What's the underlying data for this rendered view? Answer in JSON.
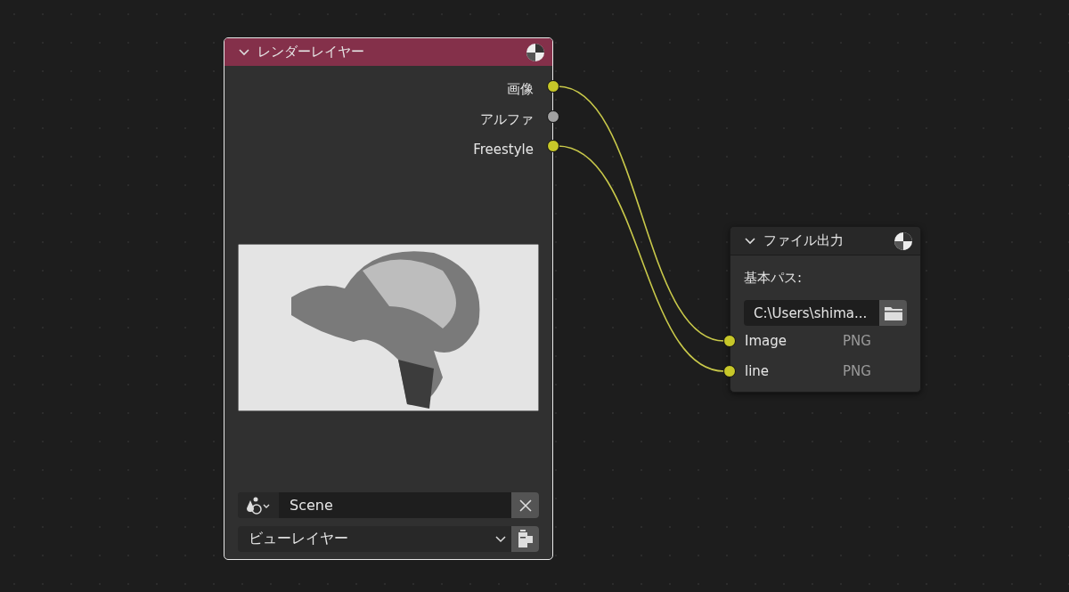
{
  "render_layers_node": {
    "title": "レンダーレイヤー",
    "expanded": true,
    "outputs": [
      {
        "label": "画像",
        "color": "#c7c729",
        "linked": true
      },
      {
        "label": "アルファ",
        "color": "#a1a1a1",
        "linked": false
      },
      {
        "label": "Freestyle",
        "color": "#c7c729",
        "linked": true
      }
    ],
    "scene_field": {
      "value": "Scene"
    },
    "view_layer_dropdown": {
      "value": "ビューレイヤー"
    }
  },
  "file_output_node": {
    "title": "ファイル出力",
    "expanded": true,
    "base_path_label": "基本パス:",
    "base_path_field": {
      "value": "C:\\Users\\shima..."
    },
    "inputs": [
      {
        "label": "Image",
        "format": "PNG",
        "color": "#c7c729",
        "linked": true
      },
      {
        "label": "line",
        "format": "PNG",
        "color": "#c7c729",
        "linked": true
      }
    ]
  }
}
